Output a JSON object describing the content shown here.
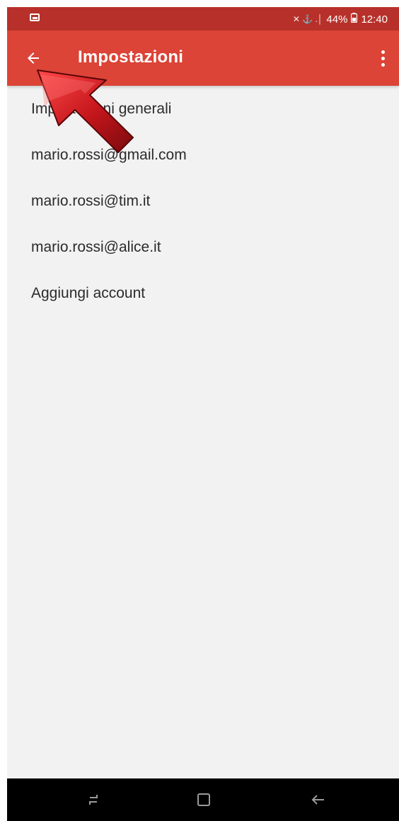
{
  "status_bar": {
    "signal_text": "✕ ⚓ .│",
    "battery": "44%",
    "battery_icon": "battery-icon",
    "time": "12:40"
  },
  "toolbar": {
    "title": "Impostazioni",
    "back_icon": "arrow-back-icon",
    "overflow_icon": "more-vert-icon"
  },
  "settings_list": [
    {
      "label": "Impostazioni generali"
    },
    {
      "label": "mario.rossi@gmail.com"
    },
    {
      "label": "mario.rossi@tim.it"
    },
    {
      "label": "mario.rossi@alice.it"
    },
    {
      "label": "Aggiungi account"
    }
  ],
  "nav_bar": {
    "recents_icon": "recents-icon",
    "home_icon": "home-icon",
    "back_icon": "nav-back-icon"
  },
  "colors": {
    "toolbar": "#db4437",
    "status_bar": "#b7312a",
    "annotation_arrow": "#c4161c"
  }
}
